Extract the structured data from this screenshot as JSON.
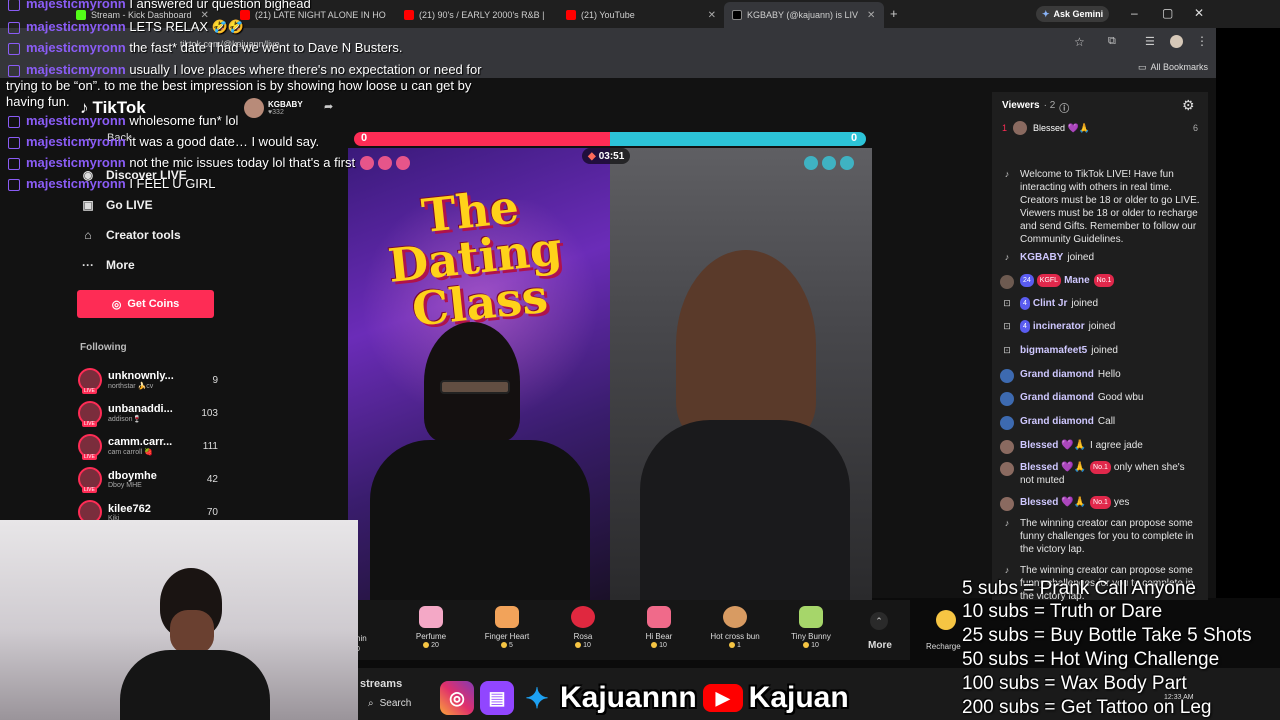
{
  "browser": {
    "tabs": [
      {
        "title": "Stream - Kick Dashboard",
        "color": "#53fc18"
      },
      {
        "title": "(21) LATE NIGHT ALONE IN HO",
        "color": "#ff0000"
      },
      {
        "title": "(21) 90's / EARLY 2000's R&B |",
        "color": "#ff0000"
      },
      {
        "title": "(21) YouTube",
        "color": "#ff0000"
      }
    ],
    "active_tab": "KGBABY (@kajuann) is LIV",
    "new_tab": "+",
    "ask_gemini": "Ask Gemini",
    "all_bookmarks": "All Bookmarks",
    "url": "tiktok.com/@kajuann/live",
    "controls": {
      "minimize": "–",
      "maximize": "▢",
      "close": "✕"
    }
  },
  "twitch_chat": [
    {
      "user": "majesticmyronn",
      "text": "I answered ur question bighead"
    },
    {
      "user": "majesticmyronn",
      "text": "LETS RELAX 🤣🤣"
    },
    {
      "user": "majesticmyronn",
      "text": "the fast* date I had we went to Dave N Busters."
    },
    {
      "user": "majesticmyronn",
      "text": "usually I love places where there's no expectation or need for",
      "cont": [
        "trying to be “on”. to me the best impression is by showing how loose u can get by",
        "having fun."
      ]
    },
    {
      "user": "majesticmyronn",
      "text": "wholesome fun* lol"
    },
    {
      "user": "majesticmyronn",
      "text": "it was a good date… I would say."
    },
    {
      "user": "majesticmyronn",
      "text": "not the mic issues today lol that's a first"
    },
    {
      "user": "majesticmyronn",
      "text": "I FEEL U GIRL"
    }
  ],
  "tiktok": {
    "logo": "TikTok",
    "back": "Back",
    "nav": [
      {
        "label": "Discover LIVE",
        "icon": "discover-icon",
        "glyph": "◉"
      },
      {
        "label": "Go LIVE",
        "icon": "camera-icon",
        "glyph": "▣"
      },
      {
        "label": "Creator tools",
        "icon": "home-icon",
        "glyph": "⌂"
      },
      {
        "label": "More",
        "icon": "more-icon",
        "glyph": "···"
      }
    ],
    "get_coins": "Get Coins",
    "following_label": "Following",
    "following": [
      {
        "name": "unknownly...",
        "sub": "northstar 🍌cv",
        "count": "9"
      },
      {
        "name": "unbanaddi...",
        "sub": "addison🍷",
        "count": "103"
      },
      {
        "name": "camm.carr...",
        "sub": "cam carroll 🍓",
        "count": "111"
      },
      {
        "name": "dboymhe",
        "sub": "Dboy MHE",
        "count": "42"
      },
      {
        "name": "kilee762",
        "sub": "Kiki",
        "count": "70"
      }
    ],
    "host": {
      "name": "KGBABY",
      "likes": "♥332"
    },
    "battle": {
      "score_left": "0",
      "score_right": "0",
      "timer": "03:51"
    },
    "video_title_line1": "The",
    "video_title_line2": "Dating",
    "video_title_line3": "Class",
    "gifts": [
      {
        "name": "Perfume",
        "price": "20",
        "color": "#f4a8c6"
      },
      {
        "name": "Finger Heart",
        "price": "5",
        "color": "#f2a35a"
      },
      {
        "name": "Rosa",
        "price": "10",
        "color": "#e0283f"
      },
      {
        "name": "Hi Bear",
        "price": "10",
        "color": "#f06a8a"
      },
      {
        "name": "Hot cross bun",
        "price": "1",
        "color": "#d89b62"
      },
      {
        "name": "Tiny Bunny",
        "price": "10",
        "color": "#a6d66a"
      }
    ],
    "gifts_more": "More",
    "recharge": "Recharge",
    "partial_gift": "hin",
    "partial_price": "0",
    "streams_label": "streams"
  },
  "viewers": {
    "title": "Viewers",
    "count": "· 2",
    "top_viewer": {
      "rank": "1",
      "name": "Blessed 💜🙏",
      "score": "6"
    }
  },
  "chat": [
    {
      "type": "sys",
      "text": "Welcome to TikTok LIVE! Have fun interacting with others in real time. Creators must be 18 or older to go LIVE. Viewers must be 18 or older to recharge and send Gifts. Remember to follow our Community Guidelines."
    },
    {
      "type": "join",
      "user": "KGBABY",
      "text": "joined"
    },
    {
      "type": "msg",
      "user": "Mane",
      "badge1": "24",
      "badge2": "KGFL",
      "badge3": "No.1",
      "text": ""
    },
    {
      "type": "join",
      "user": "Clint Jr",
      "badge1": "4",
      "text": "joined"
    },
    {
      "type": "join",
      "user": "incinerator",
      "badge1": "4",
      "text": "joined"
    },
    {
      "type": "join",
      "user": "bigmamafeet5",
      "text": "joined"
    },
    {
      "type": "msg",
      "user": "Grand diamond",
      "text": "Hello"
    },
    {
      "type": "msg",
      "user": "Grand diamond",
      "text": "Good wbu"
    },
    {
      "type": "msg",
      "user": "Grand diamond",
      "text": "Call"
    },
    {
      "type": "msg",
      "user": "Blessed 💜🙏",
      "text": "I agree jade"
    },
    {
      "type": "msg",
      "user": "Blessed 💜🙏",
      "badge3": "No.1",
      "text": "only when she's not muted"
    },
    {
      "type": "msg",
      "user": "Blessed 💜🙏",
      "badge3": "No.1",
      "text": "yes"
    },
    {
      "type": "sys",
      "text": "The winning creator can propose some funny challenges for you to complete in the victory lap."
    },
    {
      "type": "sys",
      "text": "The winning creator can propose some funny challenges for you to complete in the victory lap."
    }
  ],
  "sub_goals": [
    "5 subs = Prank Call Anyone",
    "10 subs = Truth or Dare",
    "25 subs = Buy Bottle Take 5 Shots",
    "50 subs = Hot Wing Challenge",
    "100 subs = Wax Body Part",
    "200 subs = Get Tattoo on Leg"
  ],
  "socials": {
    "handle1": "Kajuannn",
    "handle2": "Kajuan"
  },
  "taskbar": {
    "search": "Search",
    "time": "12:33 AM"
  },
  "colors": {
    "tiktok_red": "#fe2c55",
    "tiktok_cyan": "#2cc4d8",
    "twitch_purple": "#8a5cf5",
    "title_yellow": "#ffd21a"
  }
}
